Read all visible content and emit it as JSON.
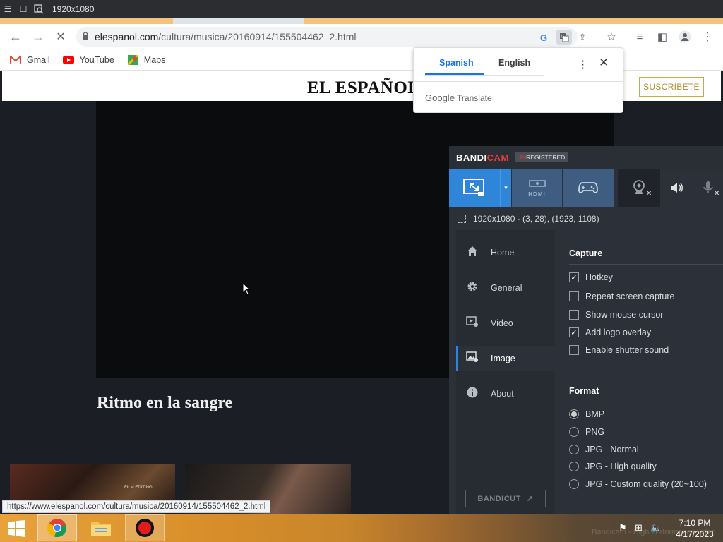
{
  "capture_toolbar": {
    "resolution": "1920x1080"
  },
  "browser": {
    "url_host": "elespanol.com",
    "url_path": "/cultura/musica/20160914/155504462_2.html",
    "bookmarks": [
      {
        "label": "Gmail",
        "icon": "gmail-icon"
      },
      {
        "label": "YouTube",
        "icon": "youtube-icon"
      },
      {
        "label": "Maps",
        "icon": "maps-icon"
      }
    ],
    "status_url": "https://www.elespanol.com/cultura/musica/20160914/155504462_2.html"
  },
  "site": {
    "logo": "EL ESPAÑOL",
    "subscribe": "SUSCRÍBETE",
    "article_title": "Ritmo en la sangre",
    "thumb1_label": "FILM EDITING"
  },
  "translate": {
    "tab_source": "Spanish",
    "tab_target": "English",
    "brand_google": "Google",
    "brand_translate": "Translate"
  },
  "bandicam": {
    "logo_bandi": "BANDI",
    "logo_cam": "CAM",
    "unreg_un": "UN",
    "unreg_rest": "REGISTERED",
    "area": "1920x1080 - (3, 28), (1923, 1108)",
    "hdmi_label": "HDMI",
    "nav": [
      {
        "label": "Home",
        "icon": "home-icon"
      },
      {
        "label": "General",
        "icon": "gear-icon"
      },
      {
        "label": "Video",
        "icon": "video-icon"
      },
      {
        "label": "Image",
        "icon": "image-settings-icon",
        "active": true
      },
      {
        "label": "About",
        "icon": "info-icon"
      }
    ],
    "bandicut": "BANDICUT",
    "capture_heading": "Capture",
    "capture_options": [
      {
        "label": "Hotkey",
        "checked": true
      },
      {
        "label": "Repeat screen capture",
        "checked": false
      },
      {
        "label": "Show mouse cursor",
        "checked": false
      },
      {
        "label": "Add logo overlay",
        "checked": true
      },
      {
        "label": "Enable shutter sound",
        "checked": false
      }
    ],
    "format_heading": "Format",
    "formats": [
      {
        "label": "BMP",
        "selected": true
      },
      {
        "label": "PNG",
        "selected": false
      },
      {
        "label": "JPG - Normal",
        "selected": false
      },
      {
        "label": "JPG - High quality",
        "selected": false
      },
      {
        "label": "JPG - Custom quality (20~100)",
        "selected": false
      }
    ]
  },
  "taskbar": {
    "time": "7:10 PM",
    "date": "4/17/2023",
    "ghost_text": "Bandicam - High performance video"
  },
  "colors": {
    "accent_blue": "#2f86d8",
    "bandicam_red": "#e23b3b",
    "subscribe_gold": "#b48e2a"
  }
}
